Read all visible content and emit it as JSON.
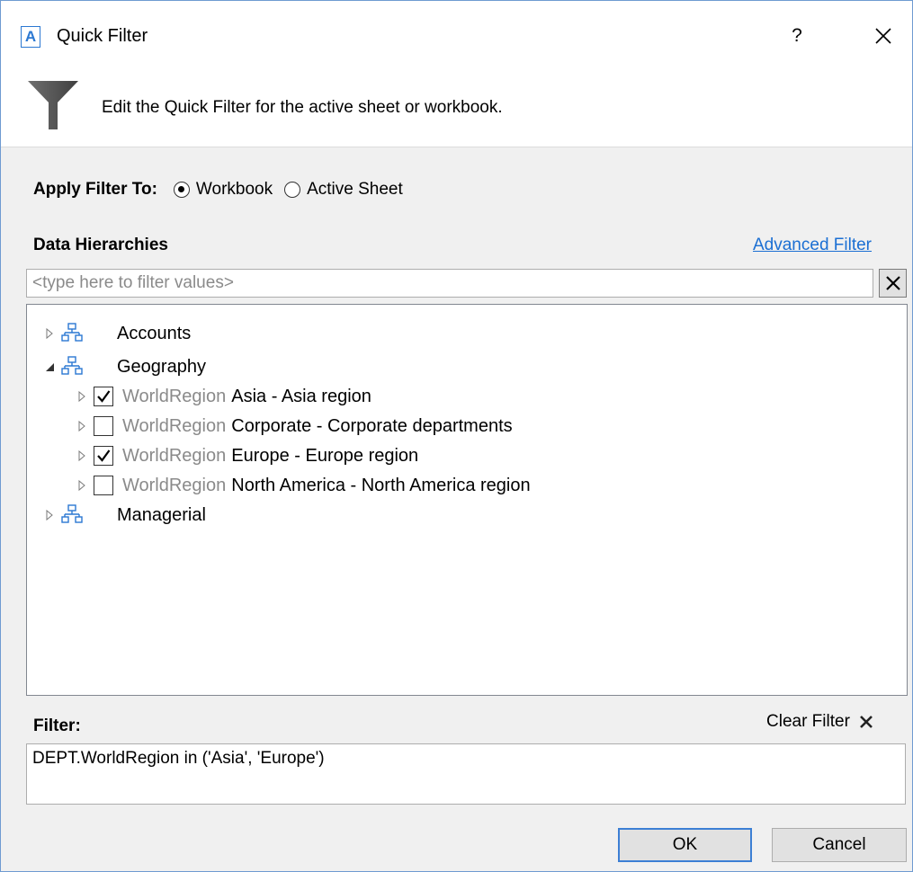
{
  "window": {
    "app_icon_letter": "A",
    "title": "Quick Filter",
    "help_label": "?"
  },
  "header": {
    "description": "Edit the Quick Filter for the active sheet or workbook."
  },
  "apply_filter": {
    "label": "Apply Filter To:",
    "options": [
      {
        "label": "Workbook",
        "selected": true
      },
      {
        "label": "Active Sheet",
        "selected": false
      }
    ]
  },
  "hierarchies": {
    "label": "Data Hierarchies",
    "advanced_link": "Advanced Filter",
    "search_placeholder": "<type here to filter values>",
    "search_value": "",
    "tree": [
      {
        "label": "Accounts",
        "expanded": false
      },
      {
        "label": "Geography",
        "expanded": true,
        "children": [
          {
            "prefix": "WorldRegion",
            "label": "Asia - Asia region",
            "checked": true
          },
          {
            "prefix": "WorldRegion",
            "label": "Corporate - Corporate departments",
            "checked": false
          },
          {
            "prefix": "WorldRegion",
            "label": "Europe - Europe region",
            "checked": true
          },
          {
            "prefix": "WorldRegion",
            "label": "North America - North America region",
            "checked": false
          }
        ]
      },
      {
        "label": "Managerial",
        "expanded": false
      }
    ]
  },
  "filter": {
    "label": "Filter:",
    "clear_label": "Clear Filter",
    "expression": "DEPT.WorldRegion in ('Asia', 'Europe')"
  },
  "buttons": {
    "ok": "OK",
    "cancel": "Cancel"
  },
  "colors": {
    "accent": "#2b78d2",
    "link": "#1b6fd3",
    "dim_text": "#8a8a8a"
  },
  "icons": [
    "app-logo-icon",
    "help-icon",
    "close-icon",
    "funnel-icon",
    "clear-search-icon",
    "expand-arrow-icon",
    "collapse-arrow-icon",
    "hierarchy-icon",
    "checkmark-icon",
    "clear-filter-icon"
  ]
}
